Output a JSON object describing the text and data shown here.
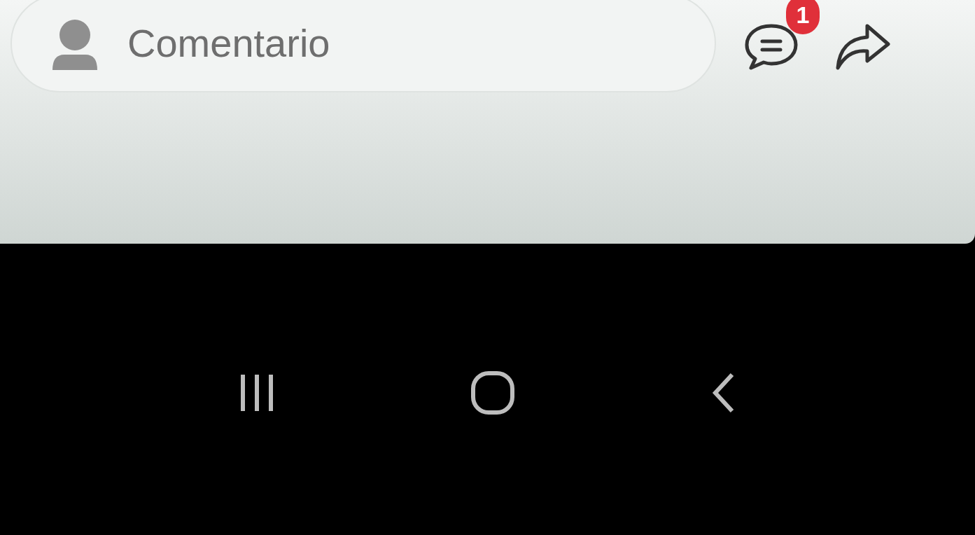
{
  "comment_field": {
    "placeholder": "Comentario"
  },
  "comments_button": {
    "badge": "1"
  }
}
